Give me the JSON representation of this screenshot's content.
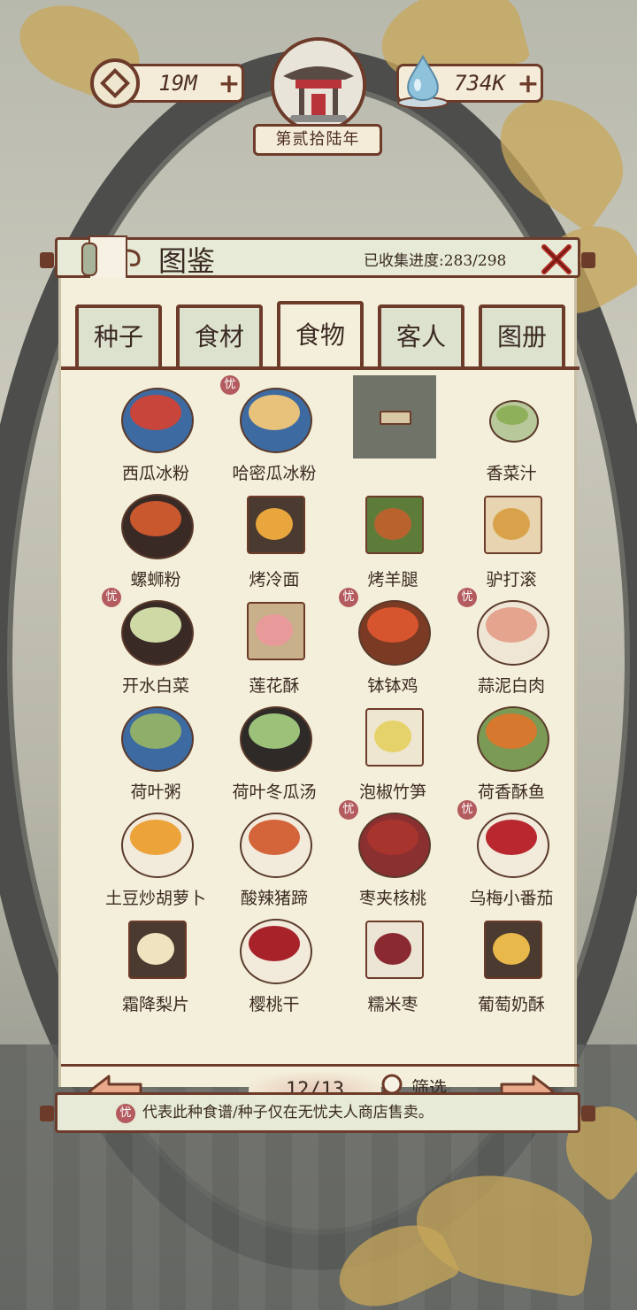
{
  "resources": {
    "coins": "19M",
    "water": "734K",
    "year": "第贰拾陆年"
  },
  "panel": {
    "title": "图鉴",
    "progress": "已收集进度:283/298",
    "tabs": [
      "种子",
      "食材",
      "食物",
      "客人",
      "图册"
    ],
    "active_tab": "食物"
  },
  "dishes": [
    {
      "name": "西瓜冰粉",
      "badge": false,
      "style": "bowl",
      "plate": "#3d6aa0",
      "food": "#c8453b"
    },
    {
      "name": "哈密瓜冰粉",
      "badge": true,
      "style": "bowl",
      "plate": "#3d6aa0",
      "food": "#e8c27a"
    },
    {
      "name": "",
      "badge": false,
      "style": "locked",
      "plate": "",
      "food": ""
    },
    {
      "name": "香菜汁",
      "badge": false,
      "style": "cup",
      "plate": "#b8c89a",
      "food": "#8fb05a"
    },
    {
      "name": "螺蛳粉",
      "badge": false,
      "style": "pot",
      "plate": "#3a2a26",
      "food": "#c9582f"
    },
    {
      "name": "烤冷面",
      "badge": false,
      "style": "tray",
      "plate": "#4a3a30",
      "food": "#e8a63c"
    },
    {
      "name": "烤羊腿",
      "badge": false,
      "style": "tray",
      "plate": "#5d7c3a",
      "food": "#b8632e"
    },
    {
      "name": "驴打滚",
      "badge": false,
      "style": "tray",
      "plate": "#e8d4b0",
      "food": "#d9a24a"
    },
    {
      "name": "开水白菜",
      "badge": true,
      "style": "pot",
      "plate": "#3a2a26",
      "food": "#cfd9a6"
    },
    {
      "name": "莲花酥",
      "badge": false,
      "style": "tray",
      "plate": "#c7b08a",
      "food": "#e89a9a"
    },
    {
      "name": "钵钵鸡",
      "badge": true,
      "style": "pot",
      "plate": "#7a3a24",
      "food": "#d6542e"
    },
    {
      "name": "蒜泥白肉",
      "badge": true,
      "style": "plate",
      "plate": "#f0e6d6",
      "food": "#e4a48e"
    },
    {
      "name": "荷叶粥",
      "badge": false,
      "style": "bowl",
      "plate": "#3d6aa0",
      "food": "#8fae6a"
    },
    {
      "name": "荷叶冬瓜汤",
      "badge": false,
      "style": "pot",
      "plate": "#2e2a28",
      "food": "#9cc27a"
    },
    {
      "name": "泡椒竹笋",
      "badge": false,
      "style": "tray",
      "plate": "#eee6d0",
      "food": "#e6d26a"
    },
    {
      "name": "荷香酥鱼",
      "badge": false,
      "style": "plate",
      "plate": "#7a9a55",
      "food": "#d6782e"
    },
    {
      "name": "土豆炒胡萝卜",
      "badge": false,
      "style": "plate",
      "plate": "#f2ebdc",
      "food": "#eba33a"
    },
    {
      "name": "酸辣猪蹄",
      "badge": false,
      "style": "plate",
      "plate": "#f2ebdc",
      "food": "#d4643a"
    },
    {
      "name": "枣夹核桃",
      "badge": true,
      "style": "bowl",
      "plate": "#8a3030",
      "food": "#a8342e"
    },
    {
      "name": "乌梅小番茄",
      "badge": true,
      "style": "plate",
      "plate": "#f2ebdc",
      "food": "#b8282e"
    },
    {
      "name": "霜降梨片",
      "badge": false,
      "style": "tray",
      "plate": "#4a3a30",
      "food": "#efe4bf"
    },
    {
      "name": "樱桃干",
      "badge": false,
      "style": "plate",
      "plate": "#f2ebdc",
      "food": "#a8222a"
    },
    {
      "name": "糯米枣",
      "badge": false,
      "style": "tray",
      "plate": "#ece4d4",
      "food": "#8a2a30"
    },
    {
      "name": "葡萄奶酥",
      "badge": false,
      "style": "tray",
      "plate": "#4a3a30",
      "food": "#e8b84a"
    }
  ],
  "badge_char": "忧",
  "footer": {
    "page": "12/13",
    "filter_label": "筛选"
  },
  "note": "代表此种食谱/种子仅在无忧夫人商店售卖。",
  "colors": {
    "frame": "#6d3b2a",
    "panel_bg": "#f4efda",
    "header_bg": "#e6ead6",
    "badge": "#b35b5e",
    "text": "#3b2a22"
  },
  "icons": {
    "coin": "square-hole-coin-icon",
    "water": "water-drop-icon",
    "close": "close-x-icon",
    "prev": "left-arrow-icon",
    "next": "right-arrow-icon",
    "filter": "magnifier-icon"
  }
}
